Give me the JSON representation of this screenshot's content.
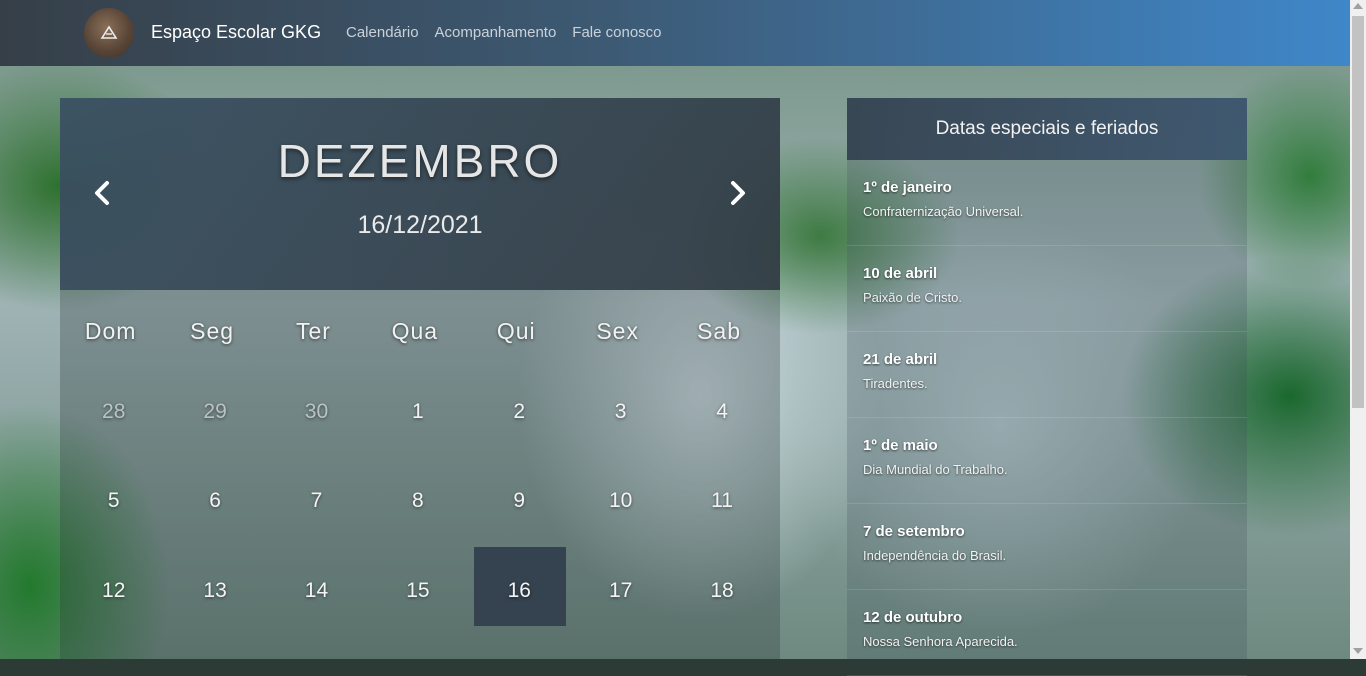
{
  "navbar": {
    "brand": "Espaço Escolar GKG",
    "links": [
      "Calendário",
      "Acompanhamento",
      "Fale conosco"
    ]
  },
  "calendar": {
    "month": "DEZEMBRO",
    "date": "16/12/2021",
    "weekdays": [
      "Dom",
      "Seg",
      "Ter",
      "Qua",
      "Qui",
      "Sex",
      "Sab"
    ],
    "weeks": [
      [
        {
          "d": "28",
          "muted": true
        },
        {
          "d": "29",
          "muted": true
        },
        {
          "d": "30",
          "muted": true
        },
        {
          "d": "1"
        },
        {
          "d": "2"
        },
        {
          "d": "3"
        },
        {
          "d": "4"
        }
      ],
      [
        {
          "d": "5"
        },
        {
          "d": "6"
        },
        {
          "d": "7"
        },
        {
          "d": "8"
        },
        {
          "d": "9"
        },
        {
          "d": "10"
        },
        {
          "d": "11"
        }
      ],
      [
        {
          "d": "12"
        },
        {
          "d": "13"
        },
        {
          "d": "14"
        },
        {
          "d": "15"
        },
        {
          "d": "16",
          "selected": true
        },
        {
          "d": "17"
        },
        {
          "d": "18"
        }
      ]
    ],
    "prev_icon": "chevron-left-icon",
    "next_icon": "chevron-right-icon"
  },
  "holidays": {
    "title": "Datas especiais e feriados",
    "items": [
      {
        "date": "1º de janeiro",
        "desc": "Confraternização Universal."
      },
      {
        "date": "10 de abril",
        "desc": "Paixão de Cristo."
      },
      {
        "date": "21 de abril",
        "desc": "Tiradentes."
      },
      {
        "date": "1º de maio",
        "desc": "Dia Mundial do Trabalho."
      },
      {
        "date": "7 de setembro",
        "desc": "Independência do Brasil."
      },
      {
        "date": "12 de outubro",
        "desc": "Nossa Senhora Aparecida."
      }
    ]
  },
  "colors": {
    "nav_start": "#363f48",
    "nav_end": "#3f87c9",
    "selected_day": "#34434f"
  }
}
